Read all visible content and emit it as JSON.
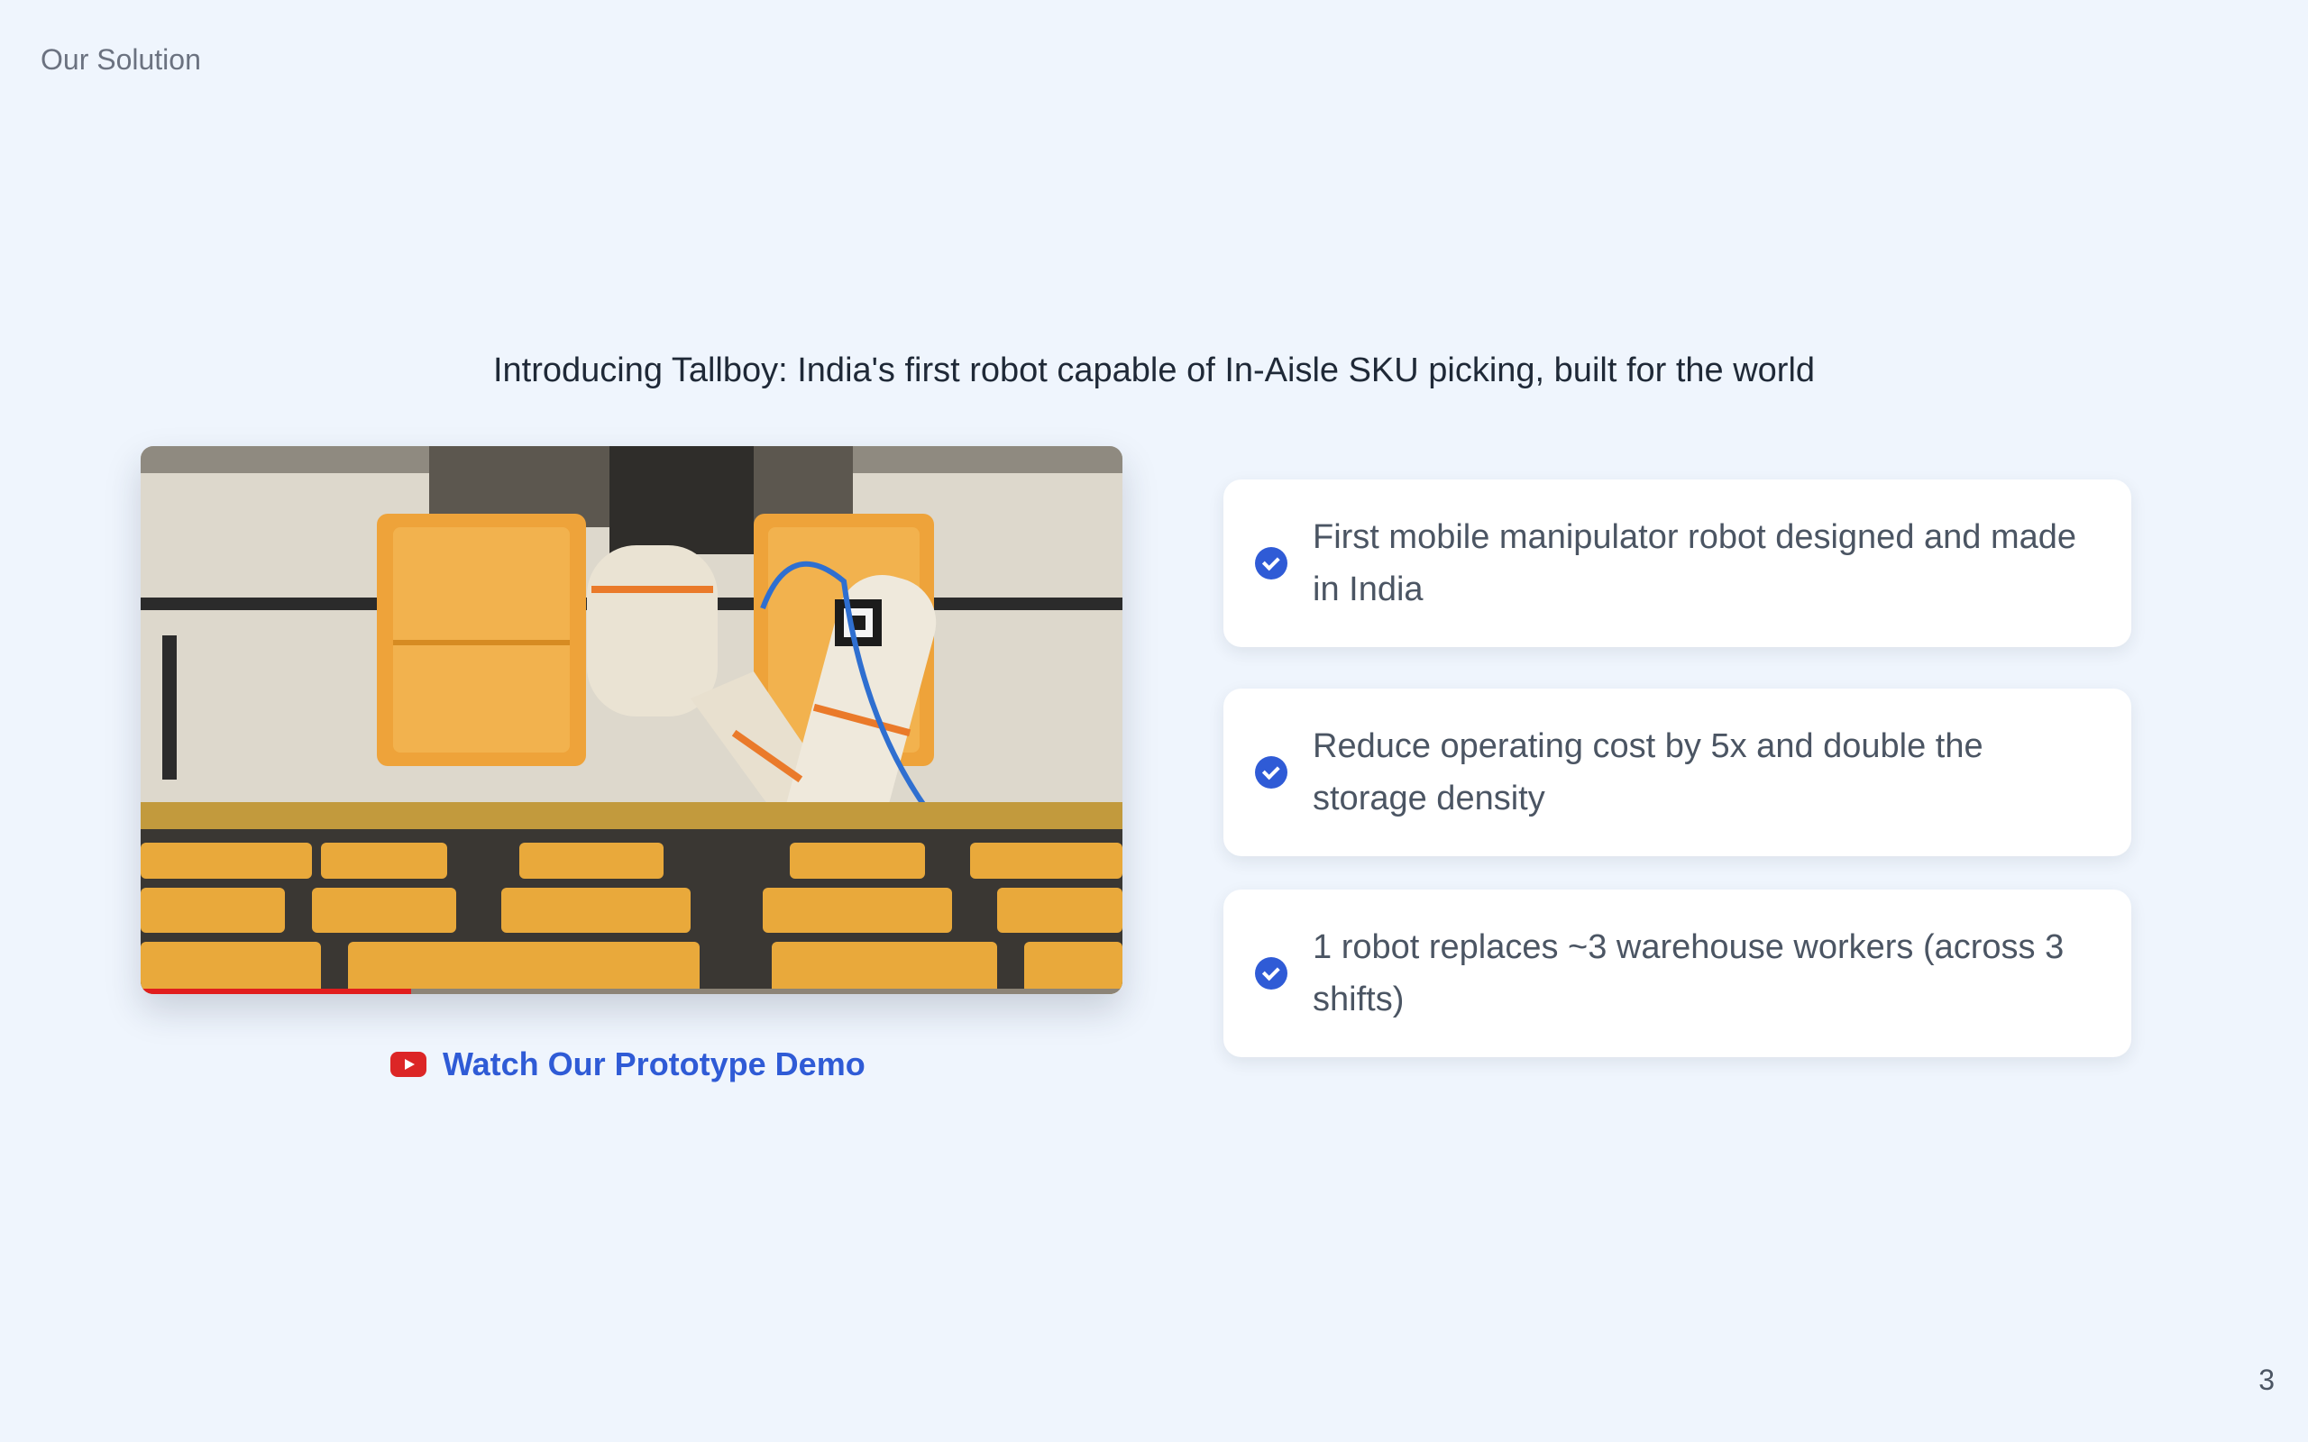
{
  "section_label": "Our Solution",
  "headline": "Introducing Tallboy: India's first robot capable of In-Aisle SKU picking, built for the world",
  "video": {
    "icon": "youtube-icon",
    "link_label": "Watch Our Prototype Demo"
  },
  "features": [
    {
      "icon": "check-circle-icon",
      "text": "First mobile manipulator robot designed and made in India"
    },
    {
      "icon": "check-circle-icon",
      "text": "Reduce operating cost by 5x and double the storage density"
    },
    {
      "icon": "check-circle-icon",
      "text": "1 robot replaces ~3 warehouse workers (across 3 shifts)"
    }
  ],
  "page_number": "3",
  "colors": {
    "background": "#eff5fd",
    "accent": "#2f5bd6",
    "youtube_red": "#dc2626",
    "text_dark": "#1f2937",
    "text_muted": "#4b5563"
  }
}
